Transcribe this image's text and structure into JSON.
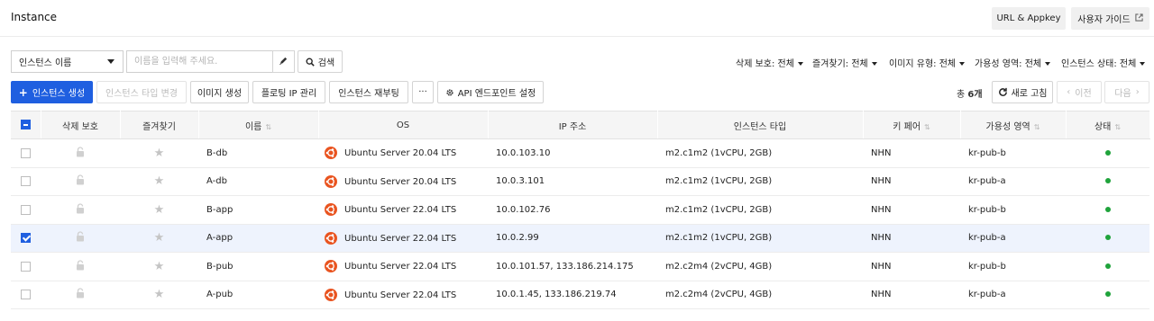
{
  "header": {
    "title": "Instance",
    "url_appkey": "URL & Appkey",
    "user_guide": "사용자 가이드"
  },
  "search": {
    "field_select": "인스턴스 이름",
    "placeholder": "이름을 입력해 주세요.",
    "button": "검색"
  },
  "filters": [
    "삭제 보호: 전체",
    "즐겨찾기: 전체",
    "이미지 유형: 전체",
    "가용성 영역: 전체",
    "인스턴스 상태: 전체"
  ],
  "toolbar": {
    "create": "인스턴스 생성",
    "change_type": "인스턴스 타입 변경",
    "create_image": "이미지 생성",
    "floating_ip": "플로팅 IP 관리",
    "reboot": "인스턴스 재부팅",
    "more": "···",
    "api_endpoint": "API 엔드포인트 설정"
  },
  "pager": {
    "total_prefix": "총",
    "total_count": "6개",
    "refresh": "새로 고침",
    "prev": "이전",
    "next": "다음"
  },
  "table": {
    "columns": [
      "삭제 보호",
      "즐겨찾기",
      "이름",
      "OS",
      "IP 주소",
      "인스턴스 타입",
      "키 페어",
      "가용성 영역",
      "상태"
    ],
    "rows": [
      {
        "checked": false,
        "name": "B-db",
        "os": "Ubuntu Server 20.04 LTS",
        "ip": "10.0.103.10",
        "type": "m2.c1m2 (1vCPU, 2GB)",
        "key_pair": "NHN",
        "zone": "kr-pub-b",
        "status": "active"
      },
      {
        "checked": false,
        "name": "A-db",
        "os": "Ubuntu Server 20.04 LTS",
        "ip": "10.0.3.101",
        "type": "m2.c1m2 (1vCPU, 2GB)",
        "key_pair": "NHN",
        "zone": "kr-pub-a",
        "status": "active"
      },
      {
        "checked": false,
        "name": "B-app",
        "os": "Ubuntu Server 22.04 LTS",
        "ip": "10.0.102.76",
        "type": "m2.c1m2 (1vCPU, 2GB)",
        "key_pair": "NHN",
        "zone": "kr-pub-b",
        "status": "active"
      },
      {
        "checked": true,
        "name": "A-app",
        "os": "Ubuntu Server 22.04 LTS",
        "ip": "10.0.2.99",
        "type": "m2.c1m2 (1vCPU, 2GB)",
        "key_pair": "NHN",
        "zone": "kr-pub-a",
        "status": "active"
      },
      {
        "checked": false,
        "name": "B-pub",
        "os": "Ubuntu Server 22.04 LTS",
        "ip": "10.0.101.57, 133.186.214.175",
        "type": "m2.c2m4 (2vCPU, 4GB)",
        "key_pair": "NHN",
        "zone": "kr-pub-b",
        "status": "active"
      },
      {
        "checked": false,
        "name": "A-pub",
        "os": "Ubuntu Server 22.04 LTS",
        "ip": "10.0.1.45, 133.186.219.74",
        "type": "m2.c2m4 (2vCPU, 4GB)",
        "key_pair": "NHN",
        "zone": "kr-pub-a",
        "status": "active"
      }
    ]
  },
  "colors": {
    "primary": "#1f5fe0",
    "status_active": "#1fa33b",
    "selected_row": "#eef3fd",
    "ubuntu": "#e95420"
  },
  "icons": [
    "pencil-icon",
    "search-icon",
    "plus-icon",
    "gear-icon",
    "refresh-icon",
    "external-link-icon",
    "lock-icon",
    "star-icon",
    "ubuntu-icon",
    "status-dot-icon"
  ]
}
